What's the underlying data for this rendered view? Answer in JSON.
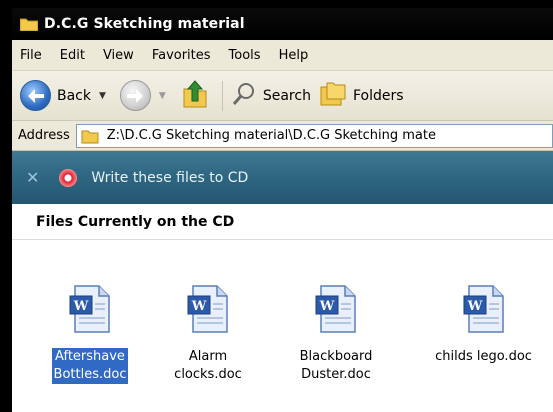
{
  "window": {
    "title": "D.C.G Sketching material"
  },
  "menu": [
    "File",
    "Edit",
    "View",
    "Favorites",
    "Tools",
    "Help"
  ],
  "toolbar": {
    "back": "Back",
    "search": "Search",
    "folders": "Folders"
  },
  "address": {
    "label": "Address",
    "value": "Z:\\D.C.G Sketching material\\D.C.G Sketching mate"
  },
  "cd_task": {
    "text": "Write these files to CD"
  },
  "section": {
    "heading": "Files Currently on the CD"
  },
  "files": [
    {
      "label": "Aftershave\nBottles.doc",
      "selected": true
    },
    {
      "label": "Alarm\nclocks.doc",
      "selected": false
    },
    {
      "label": "Blackboard\nDuster.doc",
      "selected": false
    },
    {
      "label": "childs lego.doc",
      "selected": false
    }
  ],
  "colors": {
    "selection": "#316ac5",
    "banner": "#2e6682"
  },
  "icons": [
    "folder-icon",
    "back-arrow-icon",
    "forward-arrow-icon",
    "up-folder-icon",
    "search-icon",
    "folders-icon",
    "close-icon",
    "cd-burn-icon",
    "word-doc-icon"
  ]
}
